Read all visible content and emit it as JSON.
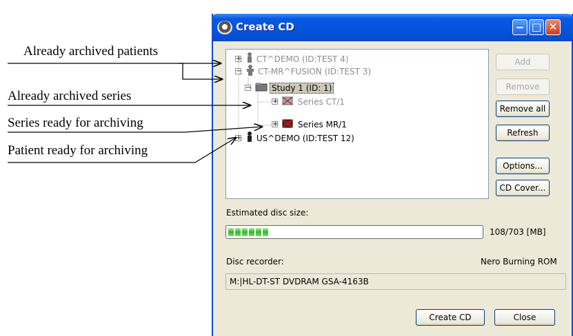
{
  "callouts": [
    "Already archived patients",
    "Already archived series",
    "Series ready for archiving",
    "Patient ready for archiving"
  ],
  "window": {
    "title": "Create CD",
    "title_buttons": [
      "minimize-icon",
      "maximize-icon",
      "close-icon"
    ]
  },
  "tree": {
    "nodes": [
      {
        "label": "CT^DEMO (ID:TEST 4)",
        "state": "archived",
        "icon": "patient-icon"
      },
      {
        "label": "CT-MR^FUSION (ID:TEST 3)",
        "state": "archived",
        "icon": "patient-icon"
      },
      {
        "label": "Study 1 (ID: 1)",
        "state": "selected",
        "icon": "study-icon"
      },
      {
        "label": "Series CT/1",
        "state": "archived",
        "icon": "series-icon"
      },
      {
        "label": "Series MR/1",
        "state": "ready",
        "icon": "series-icon"
      },
      {
        "label": "US^DEMO (ID:TEST 12)",
        "state": "ready",
        "icon": "patient-icon"
      }
    ]
  },
  "buttons": {
    "add": "Add",
    "remove": "Remove",
    "remove_all": "Remove all",
    "refresh": "Refresh",
    "options": "Options...",
    "cd_cover": "CD Cover...",
    "create_cd": "Create CD",
    "close": "Close"
  },
  "disc": {
    "size_label": "Estimated disc size:",
    "size_value": "108/703 [MB]",
    "used_fraction": 0.154,
    "recorder_label": "Disc recorder:",
    "recorder_software": "Nero Burning ROM",
    "recorder_device": "M:|HL-DT-ST DVDRAM GSA-4163B"
  },
  "colors": {
    "titlebar": "#0454dc",
    "progress": "#2fb82a",
    "dim_text": "#8c8c8c"
  }
}
